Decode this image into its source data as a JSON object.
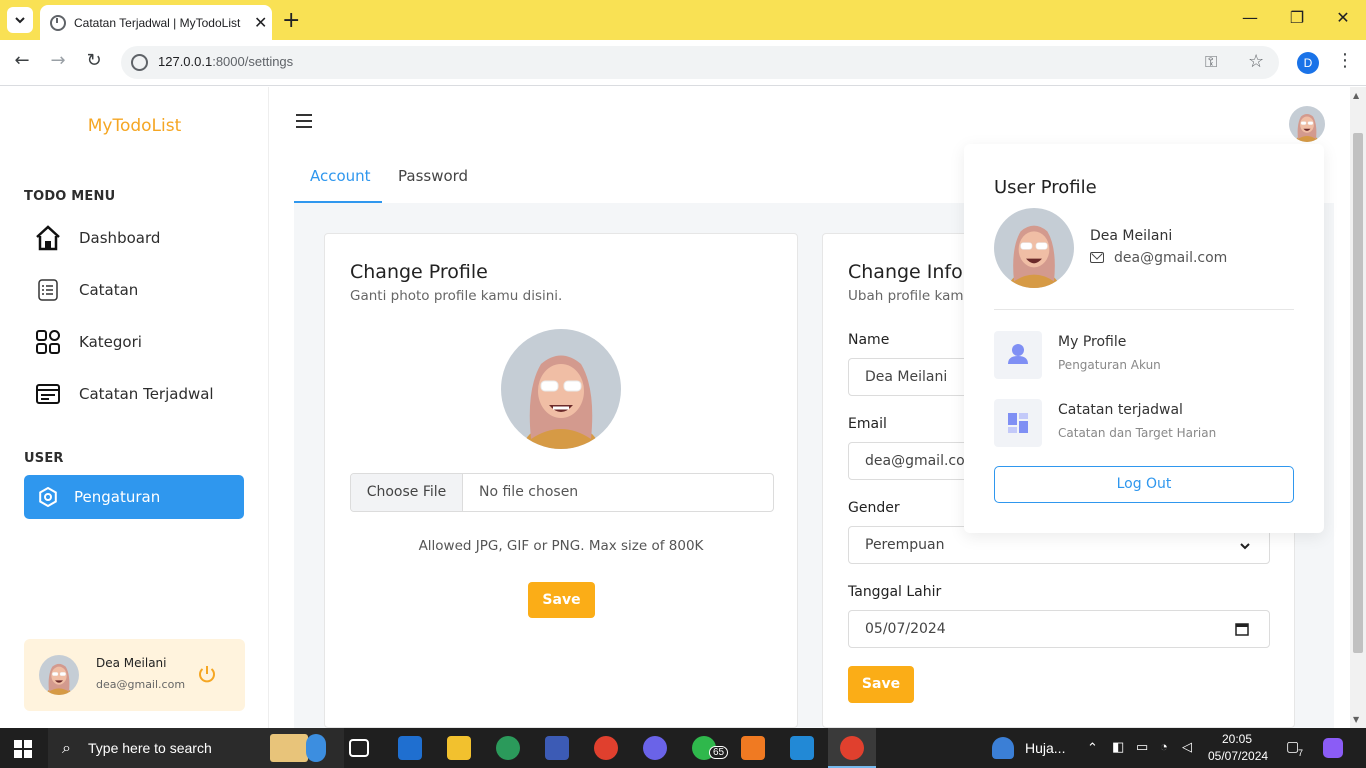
{
  "browser": {
    "tab_title": "Catatan Terjadwal | MyTodoList",
    "url_host": "127.0.0.1",
    "url_path": ":8000/settings",
    "profile_initial": "D"
  },
  "sidebar": {
    "brand": "MyTodoList",
    "todo_menu_label": "TODO MENU",
    "user_label": "USER",
    "items": [
      {
        "label": "Dashboard",
        "icon": "home-icon"
      },
      {
        "label": "Catatan",
        "icon": "notes-icon"
      },
      {
        "label": "Kategori",
        "icon": "category-icon"
      },
      {
        "label": "Catatan Terjadwal",
        "icon": "schedule-icon"
      }
    ],
    "settings_item": {
      "label": "Pengaturan",
      "icon": "settings-icon"
    },
    "user_card": {
      "name": "Dea Meilani",
      "email": "dea@gmail.com"
    }
  },
  "tabs": [
    {
      "label": "Account"
    },
    {
      "label": "Password"
    }
  ],
  "profile_card": {
    "title": "Change Profile",
    "subtitle": "Ganti photo profile kamu disini.",
    "choose_file": "Choose File",
    "no_file": "No file chosen",
    "allowed": "Allowed JPG, GIF or PNG. Max size of 800K",
    "save": "Save"
  },
  "info_card": {
    "title": "Change Inforr",
    "subtitle": "Ubah profile kamu",
    "name_label": "Name",
    "name_value": "Dea Meilani",
    "email_label": "Email",
    "email_value": "dea@gmail.cor",
    "gender_label": "Gender",
    "gender_value": "Perempuan",
    "dob_label": "Tanggal Lahir",
    "dob_value": "05/07/2024",
    "save": "Save"
  },
  "dropdown": {
    "title": "User Profile",
    "name": "Dea Meilani",
    "email": "dea@gmail.com",
    "items": [
      {
        "title": "My Profile",
        "sub": "Pengaturan Akun",
        "icon": "person-icon"
      },
      {
        "title": "Catatan terjadwal",
        "sub": "Catatan dan Target Harian",
        "icon": "grid-icon"
      }
    ],
    "logout": "Log Out"
  },
  "taskbar": {
    "search_placeholder": "Type here to search",
    "whatsapp_badge": "65",
    "weather": "Huja...",
    "time": "20:05",
    "date": "05/07/2024",
    "notifications": "7"
  },
  "colors": {
    "brand": "#f5a623",
    "primary": "#2f97ee",
    "save": "#fbad17",
    "chrome_tabbar": "#f9e154"
  }
}
